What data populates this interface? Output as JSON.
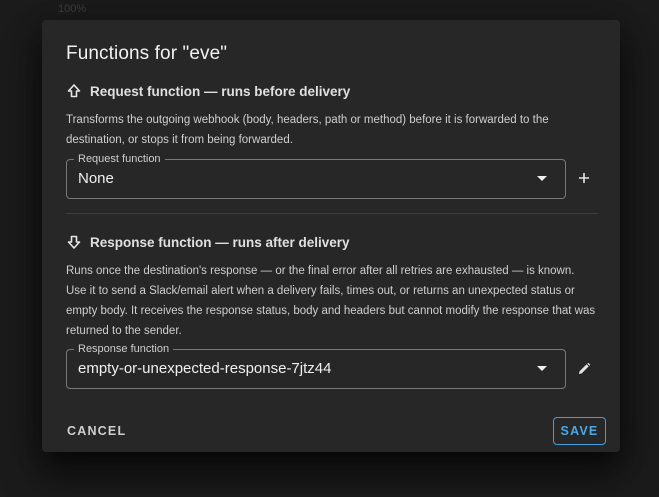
{
  "background": {
    "zoom_label": "100%"
  },
  "dialog": {
    "title": "Functions for \"eve\"",
    "request": {
      "heading": "Request function — runs before delivery",
      "description": "Transforms the outgoing webhook (body, headers, path or method) before it is forwarded to the destination, or stops it from being forwarded.",
      "field_label": "Request function",
      "field_value": "None",
      "side_icon": "plus-icon"
    },
    "response": {
      "heading": "Response function — runs after delivery",
      "description": "Runs once the destination's response — or the final error after all retries are exhausted — is known. Use it to send a Slack/email alert when a delivery fails, times out, or returns an unexpected status or empty body. It receives the response status, body and headers but cannot modify the response that was returned to the sender.",
      "field_label": "Response function",
      "field_value": "empty-or-unexpected-response-7jtz44",
      "side_icon": "pencil-icon"
    },
    "actions": {
      "cancel": "CANCEL",
      "save": "SAVE"
    }
  },
  "colors": {
    "accent": "#4aa8e6",
    "surface": "#272727",
    "backdrop": "#1c1c1c"
  }
}
